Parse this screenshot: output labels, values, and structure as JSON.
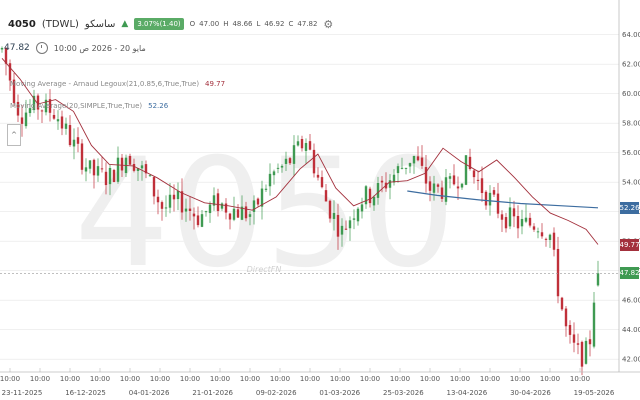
{
  "header": {
    "symbol_code": "4050",
    "symbol_ticker": "(TDWL)",
    "symbol_name": "ساسكو",
    "change_badge": "3.07%(1.40)",
    "ohlc": {
      "o_label": "O",
      "o": "47.00",
      "h_label": "H",
      "h": "48.66",
      "l_label": "L",
      "l": "46.92",
      "c_label": "C",
      "c": "47.82"
    }
  },
  "subheader": {
    "last_price": "47.82",
    "datetime": "مايو 20 - 2026 ص 10:00"
  },
  "indicators": [
    {
      "name": "Moving Average - Arnaud Legoux(21,0.85,6,True,True)",
      "value": "49.77"
    },
    {
      "name": "Moving Average(20,SIMPLE,True,True)",
      "value": "52.26"
    }
  ],
  "watermark": "4050",
  "brand_watermark": "DirectFN",
  "price_tags": {
    "sma": "52.26",
    "alma": "49.77",
    "last": "47.82"
  },
  "colors": {
    "up": "#3f9a52",
    "down": "#c0303a",
    "alma": "#a3303c",
    "sma": "#3d6da0",
    "grid": "#e6e6e6",
    "axis_text": "#555555"
  },
  "chart_data": {
    "type": "candlestick",
    "ylim": [
      41.4,
      65.4
    ],
    "yticks": [
      "64.00",
      "62.00",
      "60.00",
      "58.00",
      "56.00",
      "54.00",
      "52.00",
      "50.00",
      "48.00",
      "46.00",
      "44.00",
      "42.00"
    ],
    "x_time_labels": [
      "10:00",
      "10:00",
      "10:00",
      "10:00",
      "10:00",
      "10:00",
      "10:00",
      "10:00",
      "10:00",
      "10:00",
      "10:00",
      "10:00",
      "10:00",
      "10:00",
      "10:00",
      "10:00",
      "10:00",
      "10:00",
      "10:00",
      "10:00"
    ],
    "x_date_labels": [
      "23-11-2025",
      "16-12-2025",
      "04-01-2026",
      "21-01-2026",
      "09-02-2026",
      "01-03-2026",
      "25-03-2026",
      "13-04-2026",
      "30-04-2026",
      "19-05-2026"
    ],
    "sma_series": [
      [
        0.68,
        53.4
      ],
      [
        0.73,
        53.1
      ],
      [
        0.8,
        52.8
      ],
      [
        0.87,
        52.55
      ],
      [
        0.94,
        52.4
      ],
      [
        1.0,
        52.26
      ]
    ],
    "alma_series": [
      [
        0.0,
        62.4
      ],
      [
        0.03,
        61.0
      ],
      [
        0.06,
        59.3
      ],
      [
        0.09,
        59.6
      ],
      [
        0.12,
        58.8
      ],
      [
        0.15,
        56.5
      ],
      [
        0.18,
        55.2
      ],
      [
        0.22,
        55.1
      ],
      [
        0.26,
        54.3
      ],
      [
        0.3,
        53.3
      ],
      [
        0.34,
        52.6
      ],
      [
        0.38,
        52.4
      ],
      [
        0.42,
        52.1
      ],
      [
        0.46,
        53.0
      ],
      [
        0.5,
        54.9
      ],
      [
        0.53,
        55.9
      ],
      [
        0.56,
        53.6
      ],
      [
        0.59,
        52.4
      ],
      [
        0.62,
        52.9
      ],
      [
        0.65,
        54.0
      ],
      [
        0.68,
        54.1
      ],
      [
        0.71,
        54.6
      ],
      [
        0.74,
        56.3
      ],
      [
        0.77,
        55.4
      ],
      [
        0.8,
        54.7
      ],
      [
        0.83,
        55.5
      ],
      [
        0.86,
        54.3
      ],
      [
        0.89,
        53.0
      ],
      [
        0.92,
        51.9
      ],
      [
        0.95,
        51.4
      ],
      [
        0.98,
        50.8
      ],
      [
        1.0,
        49.77
      ]
    ],
    "price_path": [
      [
        0.0,
        63.0
      ],
      [
        0.03,
        58.6
      ],
      [
        0.06,
        59.2
      ],
      [
        0.09,
        58.7
      ],
      [
        0.12,
        56.5
      ],
      [
        0.15,
        54.6
      ],
      [
        0.18,
        54.3
      ],
      [
        0.21,
        56.0
      ],
      [
        0.24,
        54.5
      ],
      [
        0.27,
        52.2
      ],
      [
        0.3,
        52.7
      ],
      [
        0.33,
        51.6
      ],
      [
        0.36,
        52.6
      ],
      [
        0.39,
        52.1
      ],
      [
        0.42,
        51.8
      ],
      [
        0.45,
        54.4
      ],
      [
        0.48,
        55.3
      ],
      [
        0.51,
        56.9
      ],
      [
        0.54,
        53.0
      ],
      [
        0.57,
        50.6
      ],
      [
        0.6,
        52.8
      ],
      [
        0.63,
        53.4
      ],
      [
        0.66,
        54.6
      ],
      [
        0.69,
        55.8
      ],
      [
        0.72,
        53.4
      ],
      [
        0.75,
        53.6
      ],
      [
        0.78,
        55.1
      ],
      [
        0.81,
        53.3
      ],
      [
        0.84,
        51.8
      ],
      [
        0.87,
        51.1
      ],
      [
        0.9,
        51.2
      ],
      [
        0.92,
        50.4
      ],
      [
        0.933,
        46.8
      ],
      [
        0.95,
        43.2
      ],
      [
        0.97,
        42.2
      ],
      [
        0.985,
        42.6
      ],
      [
        0.992,
        46.0
      ],
      [
        1.0,
        47.82
      ]
    ],
    "last_candle": {
      "open": 47.0,
      "high": 48.66,
      "low": 46.92,
      "close": 47.82
    }
  }
}
